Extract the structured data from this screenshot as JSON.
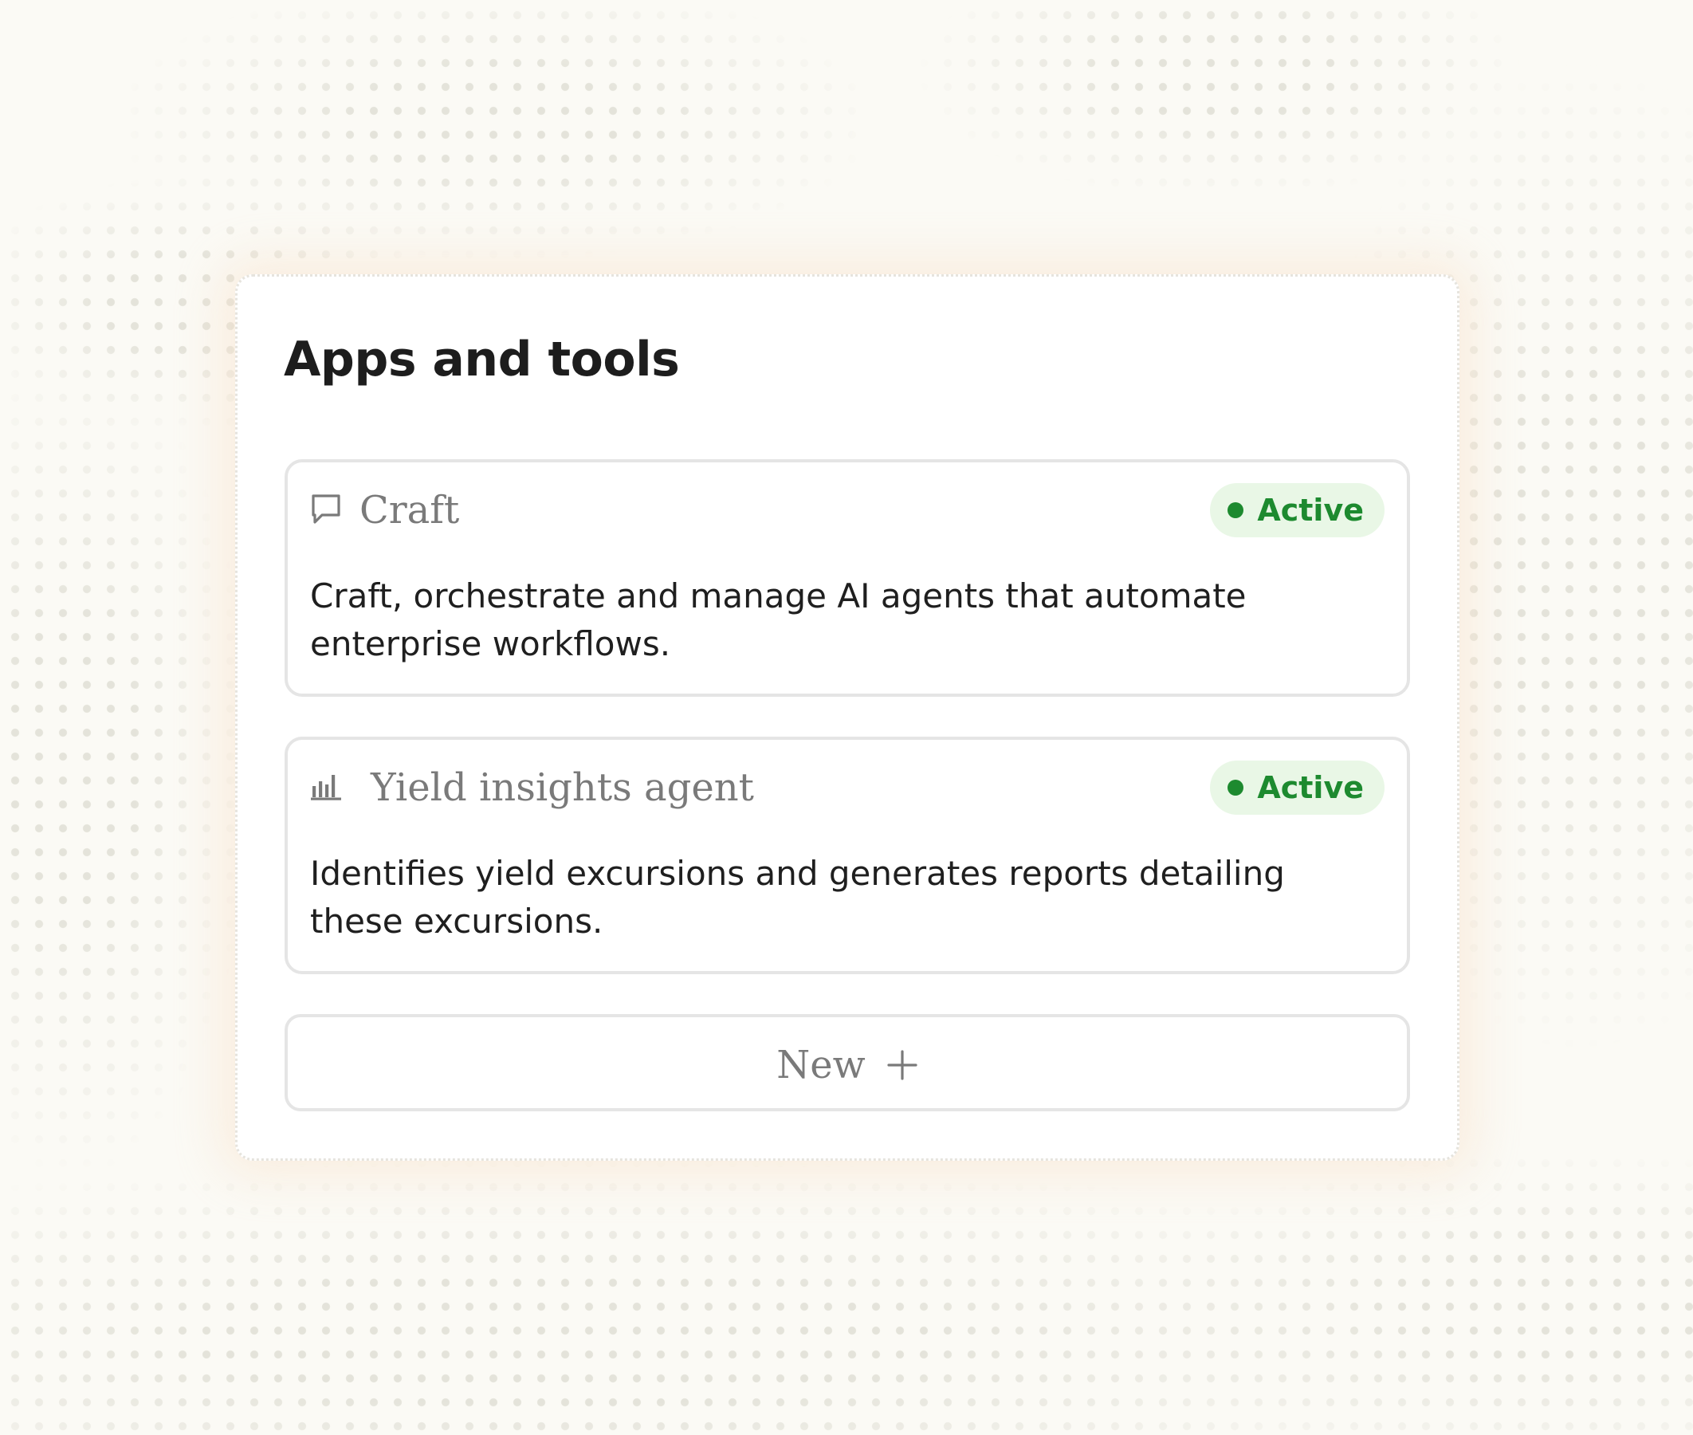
{
  "panel": {
    "title": "Apps and tools"
  },
  "apps": [
    {
      "icon": "chat-bubble-icon",
      "name": "Craft",
      "status": "Active",
      "description": "Craft, orchestrate and manage AI agents that automate enterprise workflows."
    },
    {
      "icon": "bar-chart-icon",
      "name": "Yield insights agent",
      "status": "Active",
      "description": "Identifies yield excursions and generates reports detailing these excursions."
    }
  ],
  "new_button": {
    "label": "New",
    "icon": "plus-icon"
  },
  "colors": {
    "page_background": "#fbfaf5",
    "panel_background": "#ffffff",
    "status_active_text": "#1d8a2f",
    "status_active_background": "#e9f7e6",
    "muted_text": "#7a7a7a",
    "body_text": "#1f1f1f"
  }
}
